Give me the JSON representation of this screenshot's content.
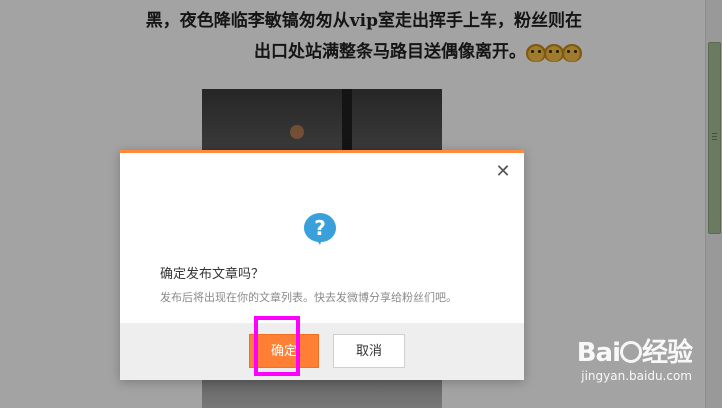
{
  "article": {
    "line1": "黑，夜色降临李敏镐匆匆从vip室走出挥手上车，粉丝则在",
    "line2": "出口处站满整条马路目送偶像离开。",
    "emoji_icon": "cartoon-faces-emoji"
  },
  "dialog": {
    "close_glyph": "✕",
    "icon": "question-icon",
    "icon_char": "?",
    "title": "确定发布文章吗？",
    "description": "发布后将出现在你的文章列表。快去发微博分享给粉丝们吧。",
    "confirm_label": "确定",
    "cancel_label": "取消",
    "accent_color": "#ff7f35",
    "icon_color": "#3aa0dc"
  },
  "annotation": {
    "highlight_color": "#ff00ff"
  },
  "watermark": {
    "logo_left": "Bai",
    "logo_right": "经验",
    "url": "jingyan.baidu.com"
  }
}
